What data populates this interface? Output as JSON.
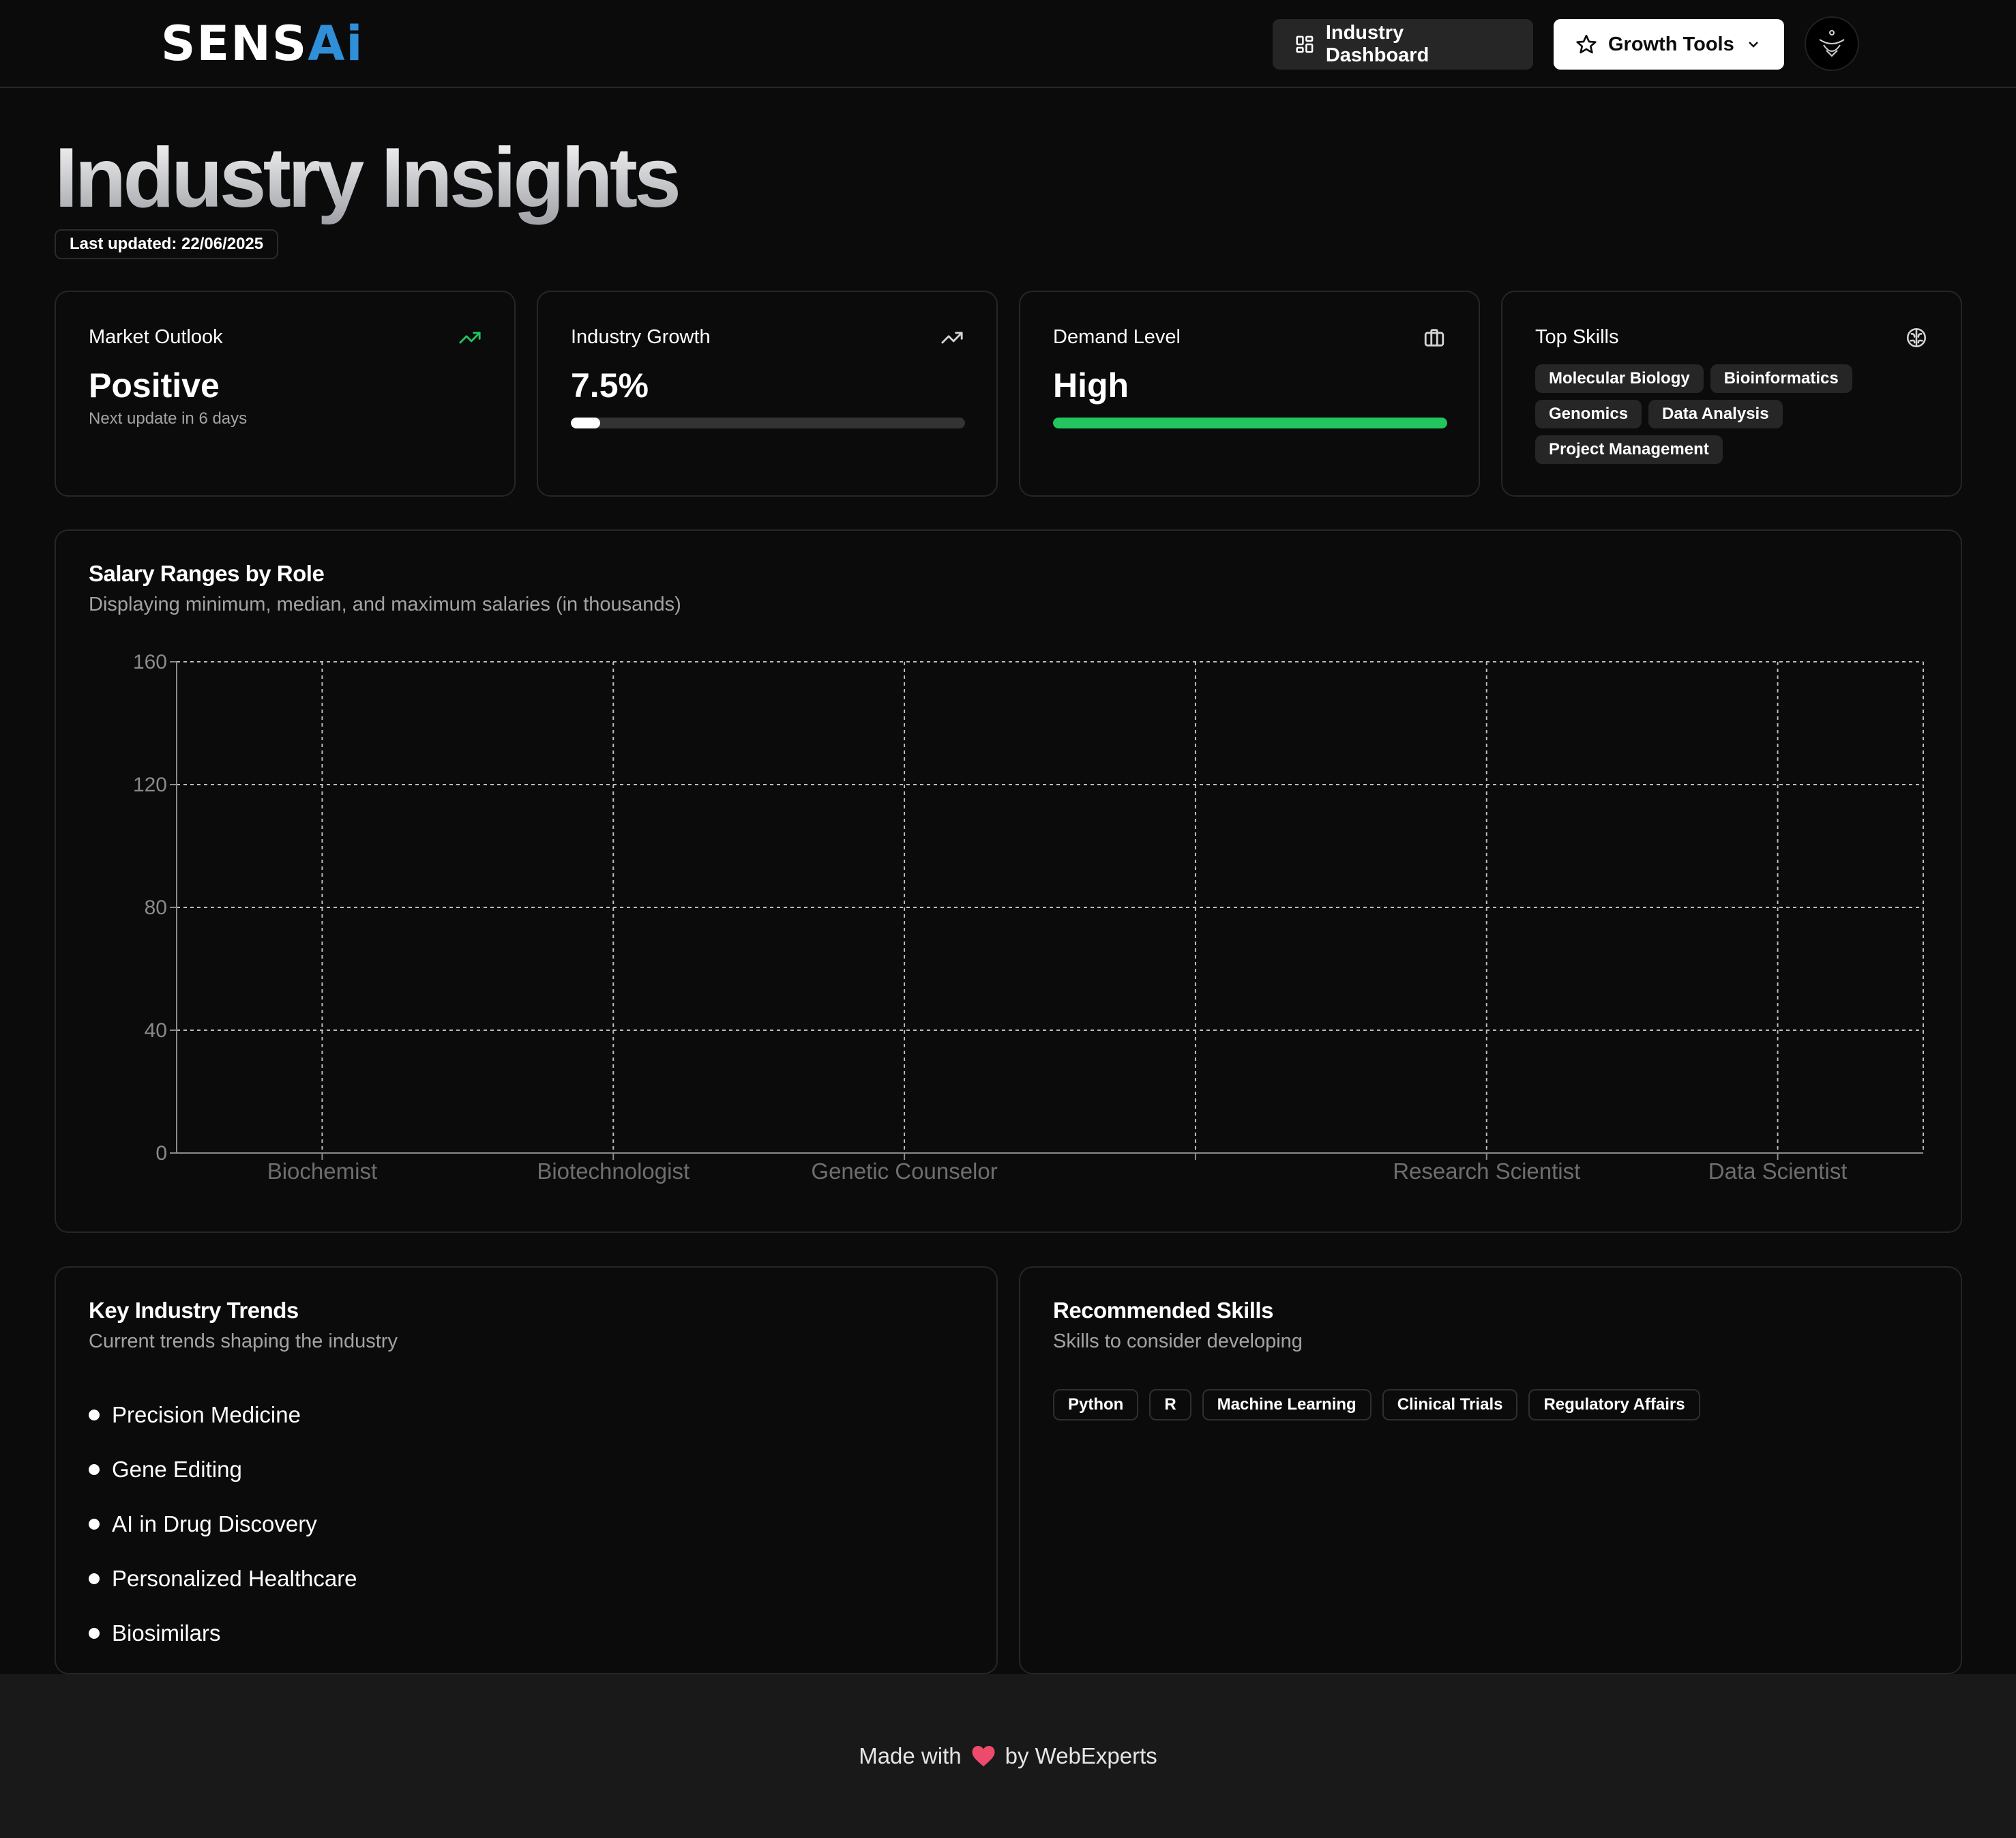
{
  "header": {
    "logo": {
      "part1": "SENS",
      "part2": "A",
      "part3": "i"
    },
    "dashboard_label": "Industry Dashboard",
    "growth_label": "Growth Tools"
  },
  "page": {
    "title": "Industry Insights",
    "last_updated": "Last updated: 22/06/2025"
  },
  "stats": {
    "market": {
      "label": "Market Outlook",
      "value": "Positive",
      "sub": "Next update in 6 days",
      "icon": "trending-up-icon",
      "icon_color": "#22c55e"
    },
    "growth": {
      "label": "Industry Growth",
      "value": "7.5%",
      "progress": 0.075,
      "icon": "trending-up-icon"
    },
    "demand": {
      "label": "Demand Level",
      "value": "High",
      "progress": 1.0,
      "bar_color": "#22c55e",
      "icon": "briefcase-icon"
    },
    "skills": {
      "label": "Top Skills",
      "icon": "brain-icon",
      "items": [
        "Molecular Biology",
        "Bioinformatics",
        "Genomics",
        "Data Analysis",
        "Project Management"
      ]
    }
  },
  "chart_card": {
    "title": "Salary Ranges by Role",
    "subtitle": "Displaying minimum, median, and maximum salaries (in thousands)"
  },
  "chart_data": {
    "type": "bar",
    "title": "Salary Ranges by Role",
    "categories": [
      "Biochemist",
      "Biotechnologist",
      "Genetic Counselor",
      "",
      "Research Scientist",
      "Data Scientist"
    ],
    "series": [],
    "ylim": [
      0,
      160
    ],
    "yticks": [
      0,
      40,
      80,
      120,
      160
    ],
    "grid": true
  },
  "trends": {
    "title": "Key Industry Trends",
    "subtitle": "Current trends shaping the industry",
    "items": [
      "Precision Medicine",
      "Gene Editing",
      "AI in Drug Discovery",
      "Personalized Healthcare",
      "Biosimilars"
    ]
  },
  "recommended": {
    "title": "Recommended Skills",
    "subtitle": "Skills to consider developing",
    "items": [
      "Python",
      "R",
      "Machine Learning",
      "Clinical Trials",
      "Regulatory Affairs"
    ]
  },
  "footer": {
    "made_with": "Made with",
    "by": "by WebExperts",
    "heart_color": "#ec4b6b"
  }
}
